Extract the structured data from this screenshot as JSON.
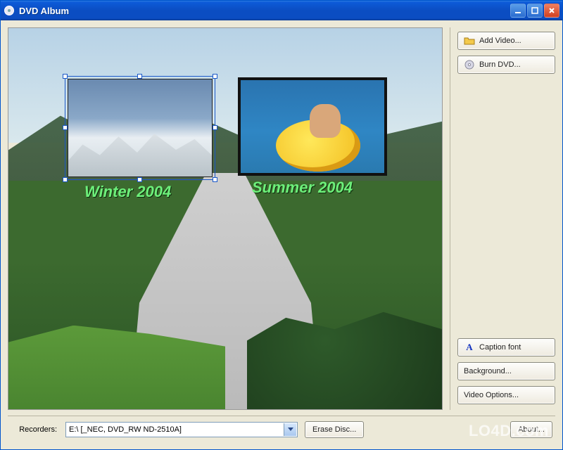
{
  "window": {
    "title": "DVD Album"
  },
  "buttons": {
    "add_video": "Add Video...",
    "burn_dvd": "Burn DVD...",
    "caption_font": "Caption font",
    "background": "Background...",
    "video_options": "Video Options...",
    "erase_disc": "Erase Disc...",
    "about": "About..."
  },
  "canvas": {
    "items": [
      {
        "id": "winter",
        "caption": "Winter 2004",
        "selected": true
      },
      {
        "id": "summer",
        "caption": "Summer 2004",
        "selected": false
      }
    ]
  },
  "bottom": {
    "recorders_label": "Recorders:",
    "recorder_selected": "E:\\ [_NEC, DVD_RW ND-2510A]"
  },
  "watermark": "LO4D.com"
}
